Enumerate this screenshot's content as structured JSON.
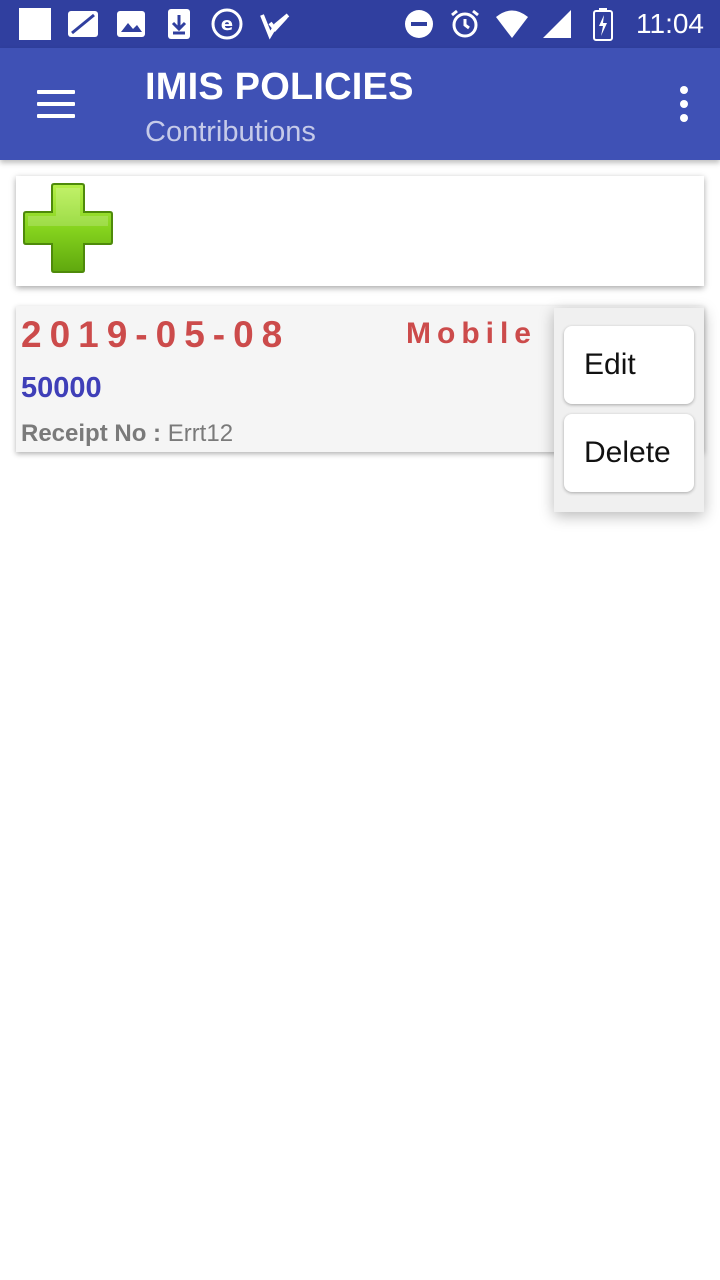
{
  "status_bar": {
    "time": "11:04",
    "icons_left": [
      "square-icon",
      "sim-icon",
      "image-icon",
      "download-icon",
      "e-icon",
      "check-icon"
    ],
    "icons_right": [
      "dnd-icon",
      "alarm-icon",
      "wifi-icon",
      "signal-icon",
      "battery-icon"
    ]
  },
  "toolbar": {
    "title": "IMIS POLICIES",
    "subtitle": "Contributions",
    "menu_icon": "hamburger-menu-icon",
    "overflow_icon": "more-vert-icon"
  },
  "add_card": {
    "icon": "add-plus-icon"
  },
  "contribution": {
    "date": "2019-05-08",
    "type": "Mobile",
    "amount": "50000",
    "receipt_label": "Receipt No :",
    "receipt_value": "Errt12"
  },
  "popup_menu": {
    "edit_label": "Edit",
    "delete_label": "Delete"
  },
  "colors": {
    "status_bar": "#303f9f",
    "toolbar": "#3f51b5",
    "subtitle": "#c5cae9",
    "date_red": "#cc4b4b",
    "amount_blue": "#3f3fb8",
    "plus_green": "#7ccc1a"
  }
}
